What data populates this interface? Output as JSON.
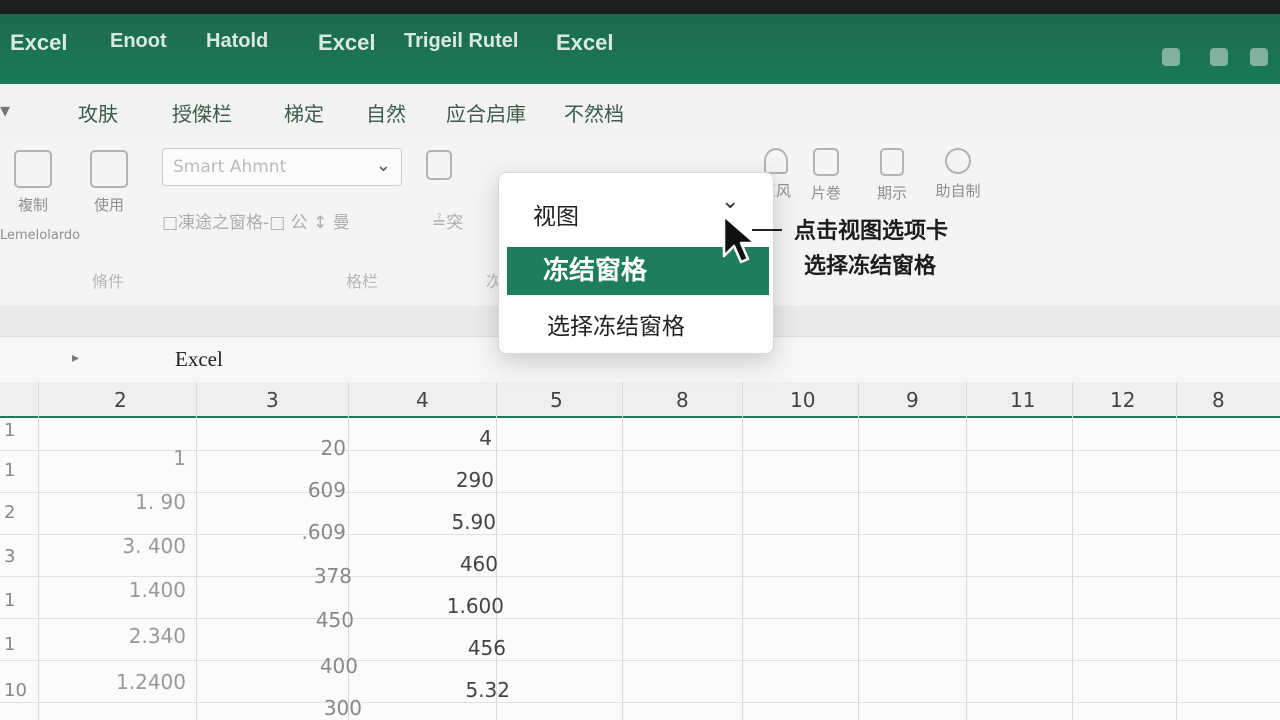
{
  "titlebar": {
    "tabs": [
      "Excel",
      "Enoot",
      "Hatold",
      "Excel",
      "Trigeil Rutel",
      "Excel"
    ]
  },
  "menubar": {
    "items": [
      "攻肤",
      "授傑栏",
      "梯定",
      "自然",
      "应合启庫",
      "不然档"
    ]
  },
  "ribbon": {
    "combo_placeholder": "Smart Ahmnt",
    "buttons": [
      "複制",
      "使用",
      "巨风",
      "片巻",
      "期示",
      "助自制"
    ],
    "small_text": "□凍途之窗格-□ 公 ↕ 曼",
    "small_text_2": "≟突",
    "sub_label": "Lemelolardo",
    "group_labels": [
      "脩件",
      "格栏",
      "次"
    ]
  },
  "formula_bar": {
    "content": "Excel"
  },
  "grid": {
    "column_headers": [
      "2",
      "3",
      "4",
      "5",
      "8",
      "10",
      "9",
      "11",
      "12",
      "8"
    ],
    "row_headers": [
      "1",
      "1",
      "2",
      "3",
      "1",
      "1",
      "10"
    ],
    "col2": [
      "1",
      "1. 90",
      "3. 400",
      "1.400",
      "2.340",
      "1.2400"
    ],
    "col3": [
      "20",
      "609",
      ".609",
      "378",
      "450",
      "400",
      "300"
    ],
    "col4": [
      "4",
      "290",
      "5.90",
      "460",
      "1.600",
      "456",
      "5.32"
    ]
  },
  "dropdown": {
    "header": "视图",
    "chevron": "⌄",
    "active_item": "冻结窗格",
    "item": "选择冻结窗格"
  },
  "annotation": {
    "line1": "点击视图选项卡",
    "line2": "选择冻结窗格"
  },
  "colors": {
    "brand_green": "#1e7d5c",
    "title_green": "#197a56"
  }
}
